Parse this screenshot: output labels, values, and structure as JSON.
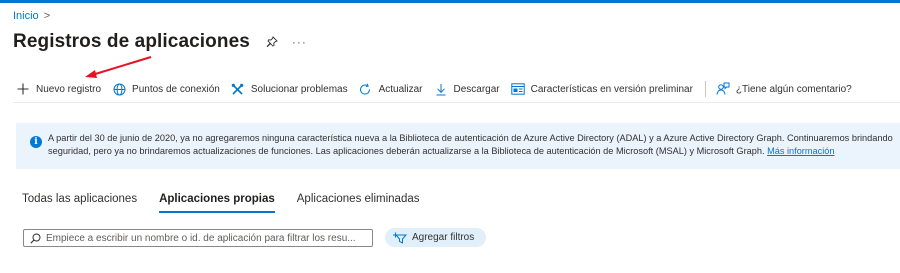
{
  "breadcrumb": {
    "home": "Inicio",
    "separator": ">"
  },
  "page": {
    "title": "Registros de aplicaciones",
    "more": "···"
  },
  "toolbar": {
    "new_registration": "Nuevo registro",
    "endpoints": "Puntos de conexión",
    "troubleshoot": "Solucionar problemas",
    "refresh": "Actualizar",
    "download": "Descargar",
    "preview_features": "Características en versión preliminar",
    "feedback": "¿Tiene algún comentario?"
  },
  "banner": {
    "line1": "A partir del 30 de junio de 2020, ya no agregaremos ninguna característica nueva a la Biblioteca de autenticación de Azure Active Directory (ADAL) y a Azure Active Directory Graph. Continuaremos brindando",
    "line2": "seguridad, pero ya no brindaremos actualizaciones de funciones. Las aplicaciones deberán actualizarse a la Biblioteca de autenticación de Microsoft (MSAL) y Microsoft Graph.",
    "link": "Más información"
  },
  "tabs": [
    {
      "label": "Todas las aplicaciones",
      "active": false
    },
    {
      "label": "Aplicaciones propias",
      "active": true
    },
    {
      "label": "Aplicaciones eliminadas",
      "active": false
    }
  ],
  "search": {
    "placeholder": "Empiece a escribir un nombre o id. de aplicación para filtrar los resu..."
  },
  "filter": {
    "label": "Agregar filtros"
  },
  "colors": {
    "accent": "#0078d4",
    "annotation_arrow": "#e81123",
    "banner_bg": "#ebf3fc"
  },
  "icons": [
    "pin-icon",
    "plus-icon",
    "globe-icon",
    "wrench-icon",
    "refresh-icon",
    "download-icon",
    "preview-icon",
    "feedback-icon",
    "info-icon",
    "search-icon",
    "filter-icon"
  ]
}
